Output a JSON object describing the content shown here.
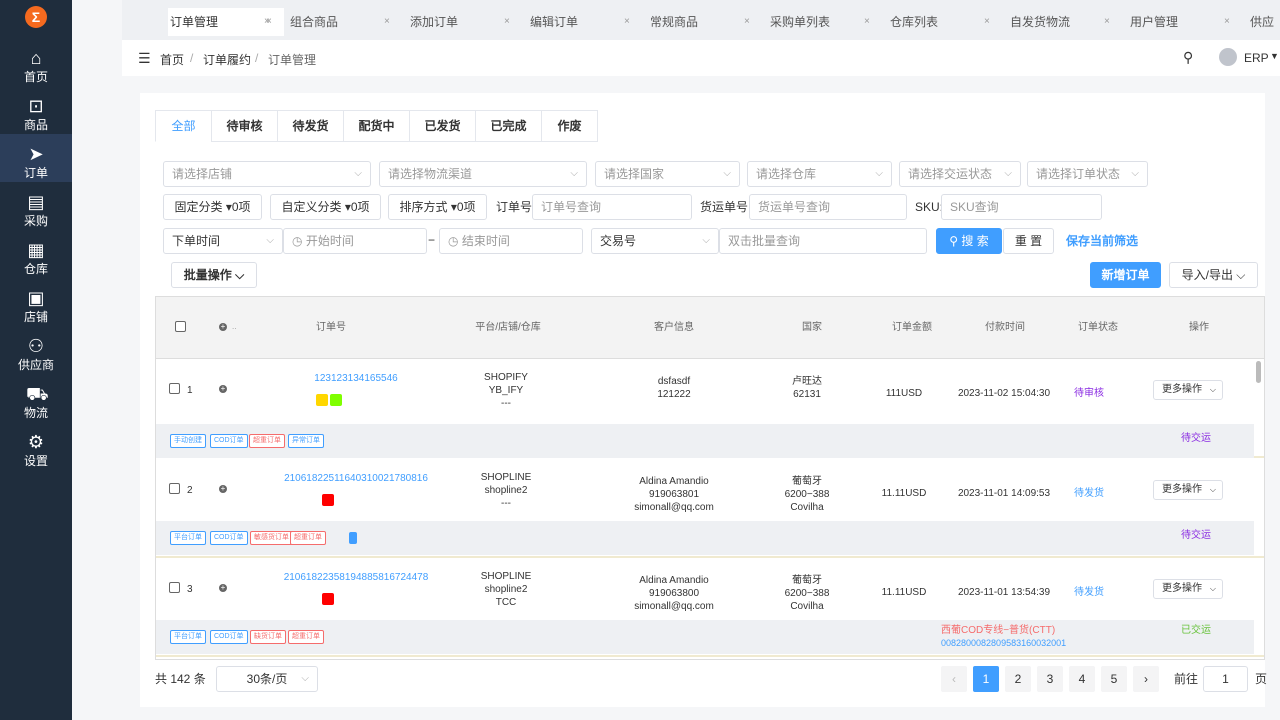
{
  "sidebar": {
    "logo": "Σ",
    "items": [
      {
        "icon": "⌂",
        "label": "首页"
      },
      {
        "icon": "⊡",
        "label": "商品"
      },
      {
        "icon": "➤",
        "label": "订单"
      },
      {
        "icon": "▤",
        "label": "采购"
      },
      {
        "icon": "▦",
        "label": "仓库"
      },
      {
        "icon": "▣",
        "label": "店铺"
      },
      {
        "icon": "⚇",
        "label": "供应商"
      },
      {
        "icon": "⛟",
        "label": "物流"
      },
      {
        "icon": "⚙",
        "label": "设置"
      }
    ]
  },
  "tabs": [
    "订单管理",
    "组合商品",
    "添加订单",
    "编辑订单",
    "常规商品",
    "采购单列表",
    "仓库列表",
    "自发货物流",
    "用户管理",
    "供应"
  ],
  "breadcrumb": [
    "首页",
    "订单履约",
    "订单管理"
  ],
  "user": "ERP",
  "filter_tabs": [
    "全部",
    "待审核",
    "待发货",
    "配货中",
    "已发货",
    "已完成",
    "作废"
  ],
  "filters": {
    "shop": "请选择店铺",
    "channel": "请选择物流渠道",
    "country": "请选择国家",
    "warehouse": "请选择仓库",
    "deliver_status": "请选择交运状态",
    "order_status": "请选择订单状态",
    "fixed_cat": "固定分类",
    "fixed_cat_count": "0项",
    "custom_cat": "自定义分类",
    "custom_cat_count": "0项",
    "sort": "排序方式",
    "sort_count": "0项",
    "order_no_label": "订单号:",
    "order_no_ph": "订单号查询",
    "ship_no_label": "货运单号:",
    "ship_no_ph": "货运单号查询",
    "sku_label": "SKU:",
    "sku_ph": "SKU查询",
    "time_type": "下单时间",
    "start_ph": "开始时间",
    "end_ph": "结束时间",
    "trade_type": "交易号",
    "batch_ph": "双击批量查询",
    "search": "搜 索",
    "reset": "重 置",
    "save_filter": "保存当前筛选",
    "batch_ops": "批量操作",
    "new_order": "新增订单",
    "import_export": "导入/导出"
  },
  "table": {
    "headers": [
      "订单号",
      "平台/店铺/仓库",
      "客户信息",
      "国家",
      "订单金额",
      "付款时间",
      "订单状态",
      "操作"
    ],
    "rows": [
      {
        "idx": "1",
        "order_no": "123123134165546",
        "platform": [
          "SHOPIFY",
          "YB_IFY",
          "---"
        ],
        "customer": [
          "dsfasdf",
          "121222",
          ""
        ],
        "country": [
          "卢旺达",
          "62131"
        ],
        "amount": "111USD",
        "paid": "2023-11-02 15:04:30",
        "status": "待审核",
        "status_color": "#8a2be2",
        "action": "更多操作",
        "tags": [
          [
            "手动创建",
            "b"
          ],
          [
            "COD订单",
            "b"
          ],
          [
            "超重订单",
            "r"
          ],
          [
            "异常订单",
            "b"
          ]
        ],
        "deliver": "待交运",
        "deliver_color": "#8a2be2",
        "logistics": "",
        "tracking": ""
      },
      {
        "idx": "2",
        "order_no": "2106182251164031002178081​6",
        "platform": [
          "SHOPLINE",
          "shopline2",
          "---"
        ],
        "customer": [
          "Aldina Amandio",
          "919063801",
          "simonall@qq.com"
        ],
        "country": [
          "葡萄牙",
          "6200−388",
          "Covilha"
        ],
        "amount": "11.11USD",
        "paid": "2023-11-01 14:09:53",
        "status": "待发货",
        "status_color": "#409eff",
        "action": "更多操作",
        "tags": [
          [
            "平台订单",
            "b"
          ],
          [
            "COD订单",
            "b"
          ],
          [
            "敏感货订单",
            "r"
          ],
          [
            "超重订单",
            "r"
          ]
        ],
        "deliver": "待交运",
        "deliver_color": "#8a2be2",
        "logistics": "",
        "tracking": ""
      },
      {
        "idx": "3",
        "order_no": "210618223581948858167244​78",
        "platform": [
          "SHOPLINE",
          "shopline2",
          "TCC"
        ],
        "customer": [
          "Aldina Amandio",
          "919063800",
          "simonall@qq.com"
        ],
        "country": [
          "葡萄牙",
          "6200−388",
          "Covilha"
        ],
        "amount": "11.11USD",
        "paid": "2023-11-01 13:54:39",
        "status": "待发货",
        "status_color": "#409eff",
        "action": "更多操作",
        "tags": [
          [
            "平台订单",
            "b"
          ],
          [
            "COD订单",
            "b"
          ],
          [
            "缺货订单",
            "r"
          ],
          [
            "超重订单",
            "r"
          ]
        ],
        "deliver": "已交运",
        "deliver_color": "#67c23a",
        "logistics": "西葡COD专线−普货(CTT)",
        "tracking": "00828000828095831600320​01"
      }
    ]
  },
  "pagination": {
    "total": "共 142 条",
    "page_size": "30条/页",
    "pages": [
      "1",
      "2",
      "3",
      "4",
      "5"
    ],
    "goto_label": "前往",
    "goto_value": "1",
    "page_unit": "页"
  },
  "colors": {
    "sidebar": "#1f2d3d",
    "accent": "#409eff",
    "logo": "#f56a1f"
  }
}
